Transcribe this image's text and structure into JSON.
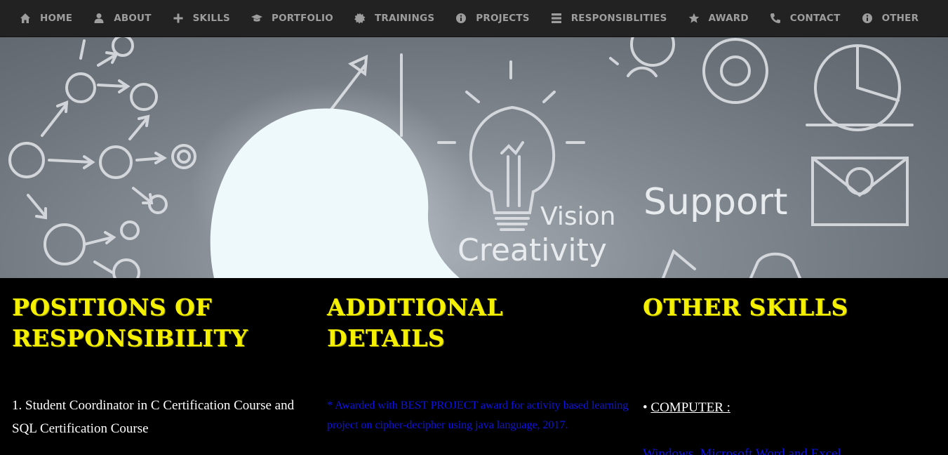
{
  "nav": {
    "items": [
      {
        "label": "HOME",
        "icon": "home-icon"
      },
      {
        "label": "ABOUT",
        "icon": "user-icon"
      },
      {
        "label": "SKILLS",
        "icon": "plus-icon"
      },
      {
        "label": "PORTFOLIO",
        "icon": "graduation-cap-icon"
      },
      {
        "label": "TRAININGS",
        "icon": "certificate-icon"
      },
      {
        "label": "PROJECTS",
        "icon": "info-icon"
      },
      {
        "label": "RESPONSIBLITIES",
        "icon": "list-icon"
      },
      {
        "label": "AWARD",
        "icon": "star-icon"
      },
      {
        "label": "CONTACT",
        "icon": "phone-icon"
      },
      {
        "label": "OTHER",
        "icon": "info-icon"
      }
    ]
  },
  "hero": {
    "words": [
      "Vision",
      "Creativity",
      "Support"
    ]
  },
  "sections": {
    "responsibility": {
      "heading": "POSITIONS OF RESPONSIBILITY",
      "item1": "1. Student Coordinator in C Certification Course and SQL Certification Course"
    },
    "additional": {
      "heading": "ADDITIONAL DETAILS",
      "item1": "* Awarded with BEST PROJECT award for activity based learning project on cipher-decipher using java language, 2017."
    },
    "other_skills": {
      "heading": "OTHER SKILLS",
      "bullet": "• ",
      "computer_label": "COMPUTER :",
      "partial_line": "Windows, Microsoft Word and Excel"
    }
  },
  "colors": {
    "nav_bg": "#222222",
    "nav_text": "#9d9d9d",
    "heading": "#f5f000",
    "blue_text": "#0d14e6"
  }
}
